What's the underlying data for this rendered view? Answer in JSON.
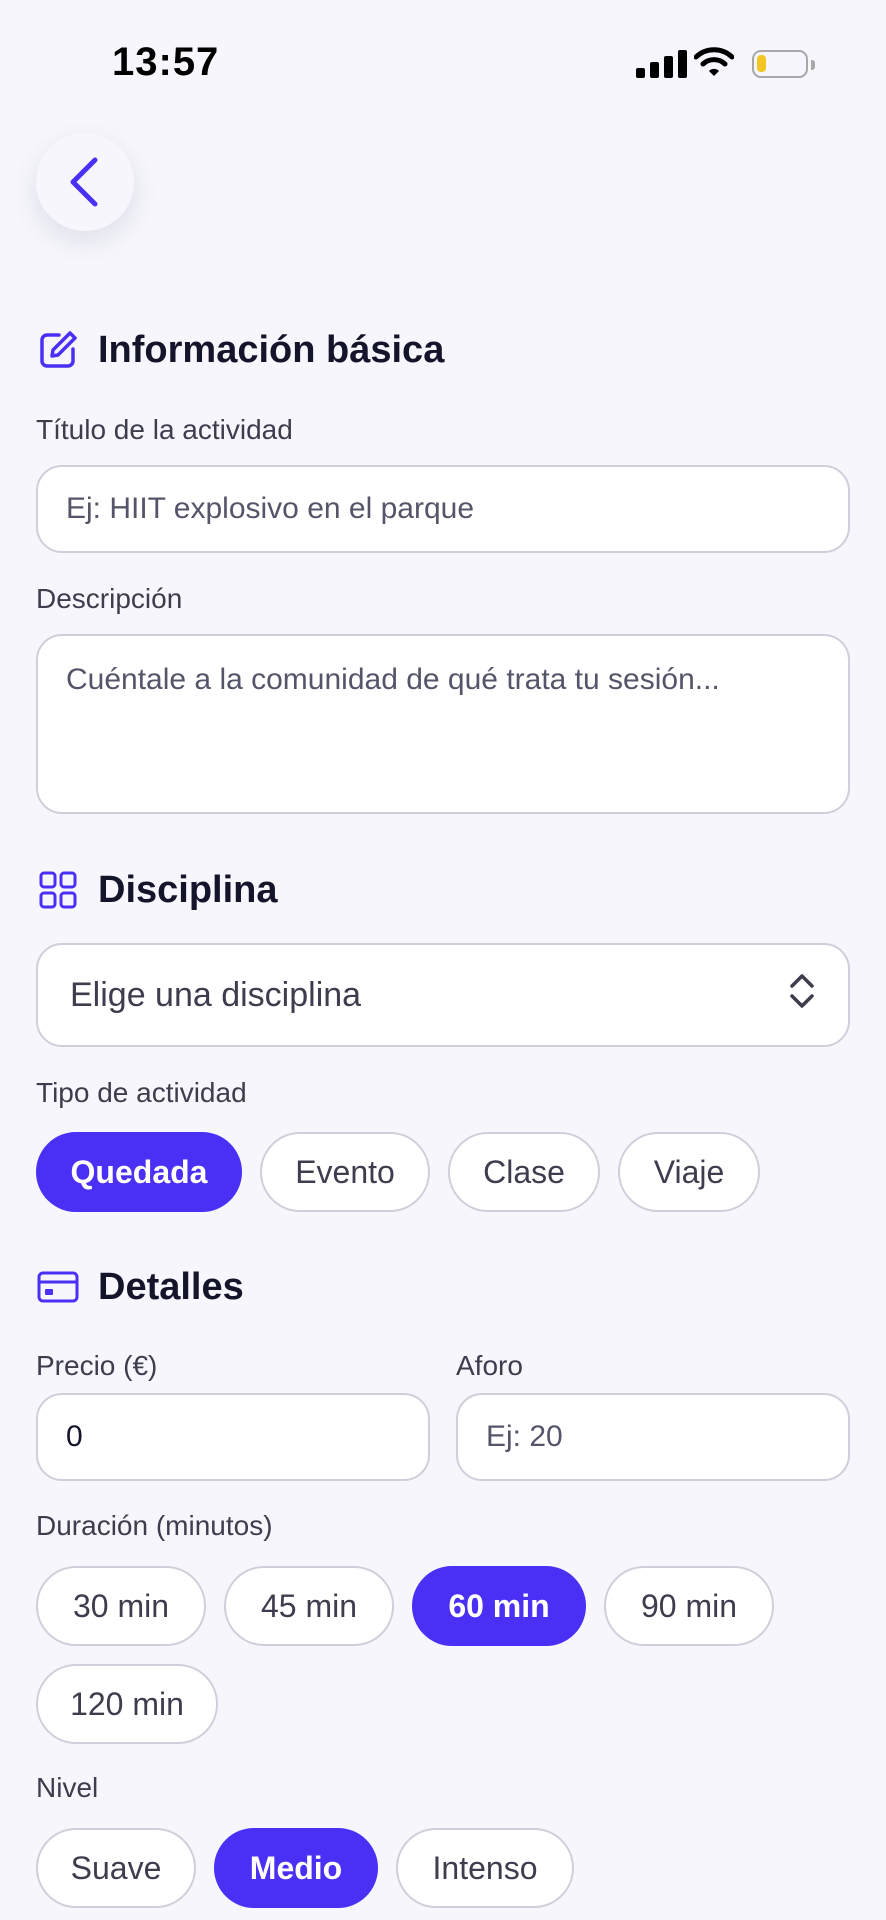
{
  "status_bar": {
    "time": "13:57"
  },
  "basic": {
    "heading": "Información básica",
    "title_label": "Título de la actividad",
    "title_placeholder": "Ej: HIIT explosivo en el parque",
    "desc_label": "Descripción",
    "desc_placeholder": "Cuéntale a la comunidad de qué trata tu sesión..."
  },
  "discipline": {
    "heading": "Disciplina",
    "select_value": "Elige una disciplina",
    "type_label": "Tipo de actividad",
    "types": [
      "Quedada",
      "Evento",
      "Clase",
      "Viaje"
    ],
    "selected_type": "Quedada"
  },
  "details": {
    "heading": "Detalles",
    "price_label": "Precio (€)",
    "price_value": "0",
    "capacity_label": "Aforo",
    "capacity_placeholder": "Ej: 20",
    "duration_label": "Duración (minutos)",
    "durations": [
      "30 min",
      "45 min",
      "60 min",
      "90 min",
      "120 min"
    ],
    "selected_duration": "60 min",
    "level_label": "Nivel",
    "levels": [
      "Suave",
      "Medio",
      "Intenso"
    ],
    "selected_level": "Medio"
  },
  "colors": {
    "accent": "#4a30f5",
    "background": "#f6f6fc",
    "border": "#cfcfdb"
  }
}
